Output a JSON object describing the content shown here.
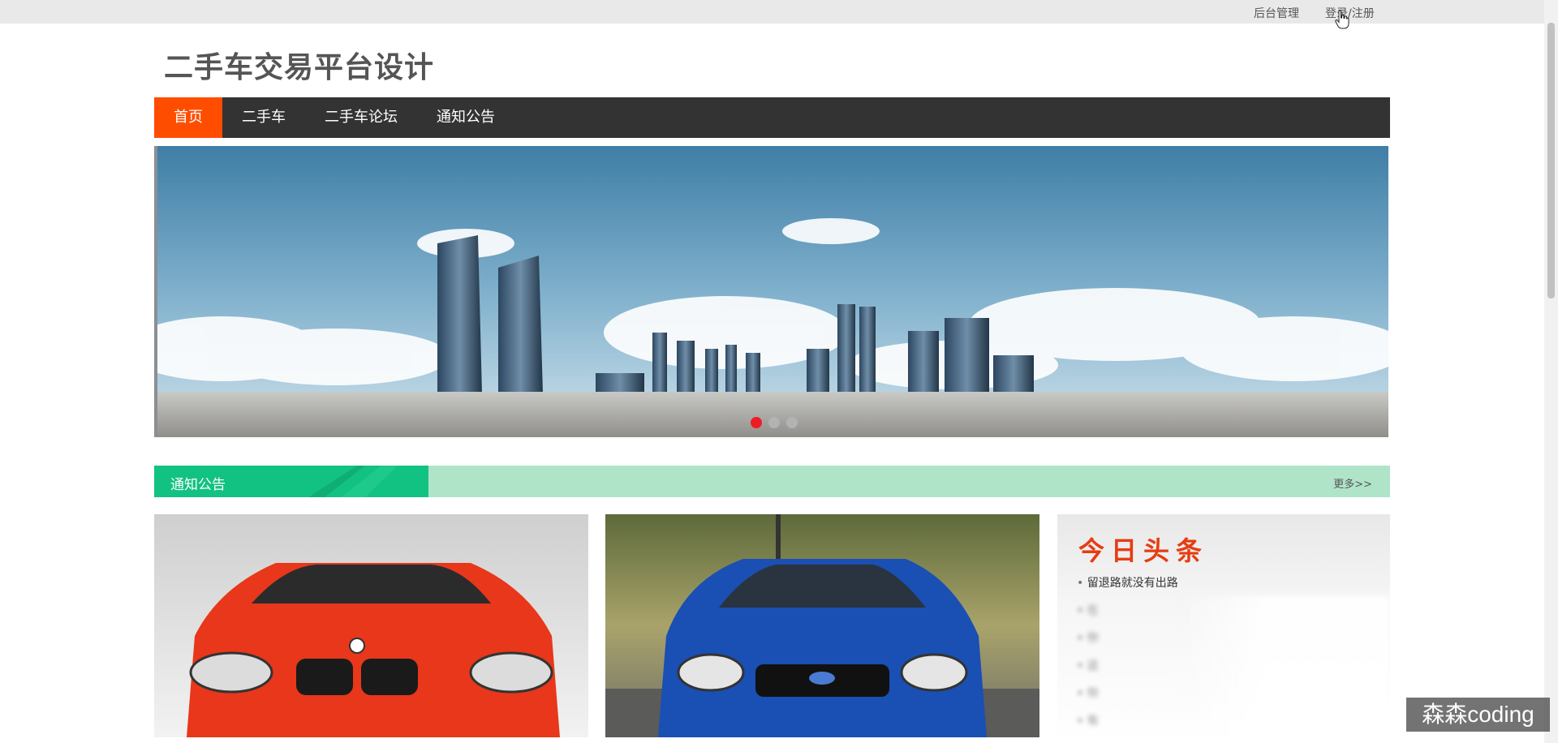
{
  "topbar": {
    "admin_label": "后台管理",
    "login_label": "登录/注册"
  },
  "site": {
    "title": "二手车交易平台设计"
  },
  "nav": {
    "items": [
      {
        "label": "首页",
        "active": true
      },
      {
        "label": "二手车",
        "active": false
      },
      {
        "label": "二手车论坛",
        "active": false
      },
      {
        "label": "通知公告",
        "active": false
      }
    ]
  },
  "banner": {
    "slide_count": 3,
    "active_slide": 1
  },
  "notice_section": {
    "title": "通知公告",
    "more_label": "更多>>"
  },
  "cars": [
    {
      "color": "#e8371a",
      "icon": "red-car-image"
    },
    {
      "color": "#1a4fb3",
      "icon": "blue-car-image"
    }
  ],
  "headlines": {
    "title": "今日头条",
    "items": [
      {
        "label": "留退路就没有出路",
        "blurred": false
      },
      {
        "label": "在",
        "blurred": true
      },
      {
        "label": "你",
        "blurred": true
      },
      {
        "label": "这",
        "blurred": true
      },
      {
        "label": "你",
        "blurred": true
      },
      {
        "label": "有",
        "blurred": true
      }
    ]
  },
  "watermark": {
    "text": "森森coding"
  },
  "colors": {
    "accent": "#ff4d00",
    "nav_bg": "#333333",
    "section_green": "#12c283",
    "section_light": "#b0e4c9",
    "headline_red": "#e63c12"
  }
}
